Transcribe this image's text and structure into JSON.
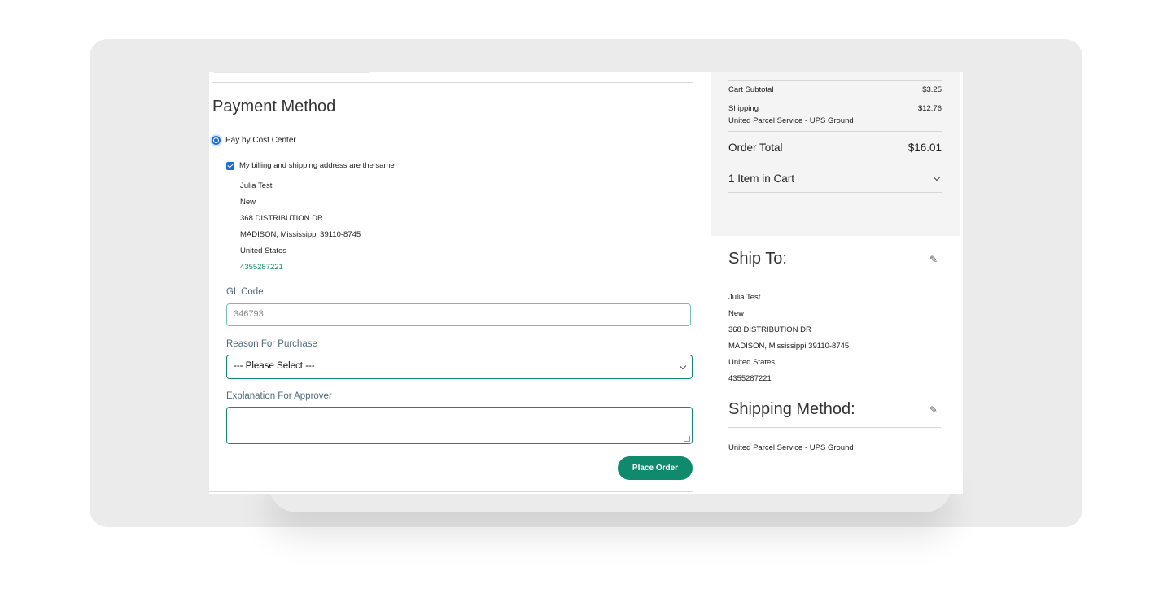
{
  "payment": {
    "title": "Payment Method",
    "option_label": "Pay by Cost Center",
    "same_address_label": "My billing and shipping address are the same"
  },
  "billing_address": {
    "name": "Julia Test",
    "line2": "New",
    "street": "368 DISTRIBUTION DR",
    "city_state_zip": "MADISON, Mississippi 39110-8745",
    "country": "United States",
    "phone": "4355287221"
  },
  "form": {
    "gl_label": "GL Code",
    "gl_value": "346793",
    "reason_label": "Reason For Purchase",
    "reason_selected": "--- Please Select ---",
    "explanation_label": "Explanation For Approver",
    "explanation_value": "",
    "place_order_label": "Place Order"
  },
  "summary": {
    "subtotal_label": "Cart Subtotal",
    "subtotal_value": "$3.25",
    "shipping_label": "Shipping",
    "shipping_value": "$12.76",
    "shipping_carrier": "United Parcel Service - UPS Ground",
    "total_label": "Order Total",
    "total_value": "$16.01",
    "cart_count_label": "1 Item in Cart"
  },
  "ship_to": {
    "title": "Ship To:",
    "name": "Julia Test",
    "line2": "New",
    "street": "368 DISTRIBUTION DR",
    "city_state_zip": "MADISON, Mississippi 39110-8745",
    "country": "United States",
    "phone": "4355287221"
  },
  "shipping_method": {
    "title": "Shipping Method:",
    "value": "United Parcel Service - UPS Ground"
  },
  "icons": {
    "edit": "pencil-icon",
    "dropdown": "chevron-down-icon"
  },
  "colors": {
    "accent": "#0f8a6c",
    "radio_checkbox": "#1b6fd1",
    "summary_bg": "#f4f4f4",
    "frame_bg": "#ebebeb"
  }
}
